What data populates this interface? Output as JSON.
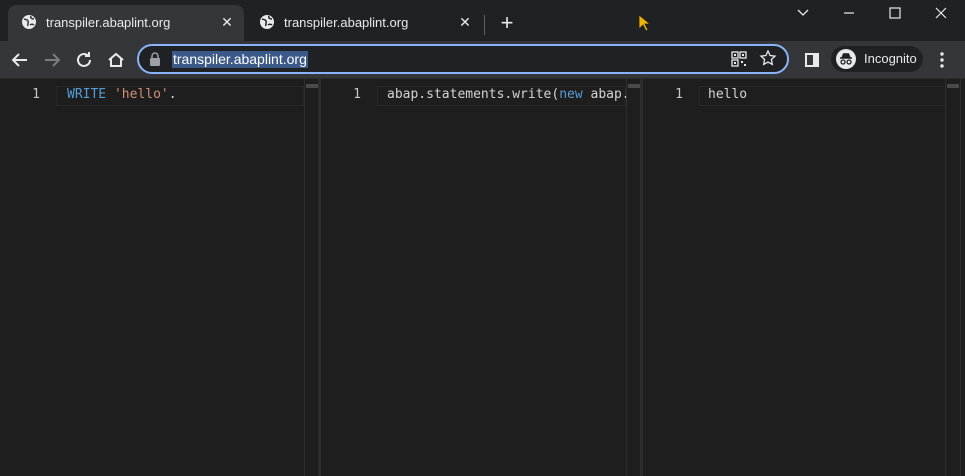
{
  "tabs": [
    {
      "title": "transpiler.abaplint.org",
      "active": true
    },
    {
      "title": "transpiler.abaplint.org",
      "active": false
    }
  ],
  "toolbar": {
    "url": "transpiler.abaplint.org",
    "incognito_label": "Incognito"
  },
  "panes": {
    "source": {
      "line_number": "1",
      "keyword": "WRITE",
      "string": "'hello'",
      "rest": "."
    },
    "transpiled": {
      "line_number": "1",
      "prefix": "abap.statements.write(",
      "keyword": "new",
      "suffix": " abap.ty"
    },
    "output": {
      "line_number": "1",
      "text": "hello"
    }
  },
  "colors": {
    "keyword": "#569cd6",
    "string": "#ce9178",
    "accent": "#8ab4f8"
  }
}
